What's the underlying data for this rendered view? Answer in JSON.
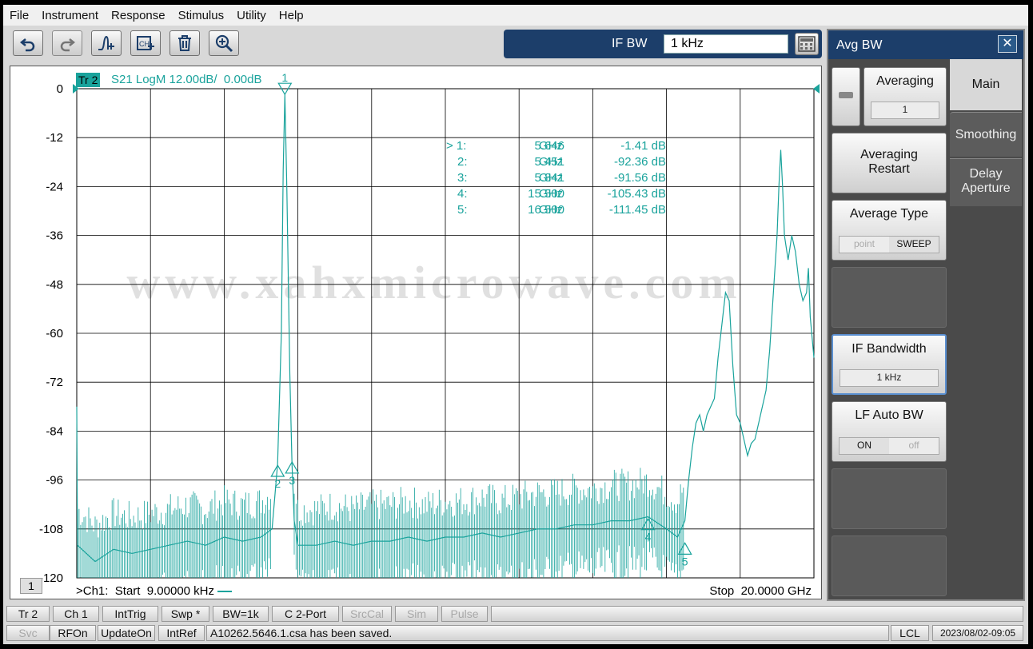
{
  "menu": [
    "File",
    "Instrument",
    "Response",
    "Stimulus",
    "Utility",
    "Help"
  ],
  "toolbar": {
    "icons": [
      "undo-icon",
      "redo-icon",
      "marker-add-icon",
      "channel-add-icon",
      "trash-icon",
      "zoom-in-icon"
    ]
  },
  "ifbw": {
    "label": "IF BW",
    "value": "1 kHz"
  },
  "trace": {
    "badge": "Tr 2",
    "label": "S21 LogM 12.00dB/  0.00dB",
    "channel_num": "1",
    "start_label": ">Ch1:  Start  9.00000 kHz",
    "stop_label": "Stop  20.0000 GHz"
  },
  "watermark": "www.xahxmicrowave.com",
  "markers": [
    {
      "id": "1",
      "prefix": "> 1:",
      "freq": "5.646",
      "unit": "GHz",
      "value": "-1.41 dB"
    },
    {
      "id": "2",
      "prefix": "2:",
      "freq": "5.451",
      "unit": "GHz",
      "value": "-92.36 dB"
    },
    {
      "id": "3",
      "prefix": "3:",
      "freq": "5.841",
      "unit": "GHz",
      "value": "-91.56 dB"
    },
    {
      "id": "4",
      "prefix": "4:",
      "freq": "15.500",
      "unit": "GHz",
      "value": "-105.43 dB"
    },
    {
      "id": "5",
      "prefix": "5:",
      "freq": "16.500",
      "unit": "GHz",
      "value": "-111.45 dB"
    }
  ],
  "chart_data": {
    "type": "line",
    "yticks": [
      "0",
      "-12",
      "-24",
      "-36",
      "-48",
      "-60",
      "-72",
      "-84",
      "-96",
      "-108",
      "-120"
    ],
    "ylim": [
      -120,
      0
    ],
    "xlim_ghz": [
      9e-06,
      20
    ],
    "grid": true,
    "series": [
      {
        "color": "#1aa39c",
        "points": [
          [
            0.0,
            -78
          ],
          [
            0.02,
            -112
          ],
          [
            0.5,
            -116
          ],
          [
            1.0,
            -113
          ],
          [
            1.5,
            -114
          ],
          [
            2.0,
            -113
          ],
          [
            2.5,
            -112
          ],
          [
            3.0,
            -111
          ],
          [
            3.5,
            -112
          ],
          [
            4.0,
            -110
          ],
          [
            4.5,
            -111
          ],
          [
            5.0,
            -110
          ],
          [
            5.3,
            -108
          ],
          [
            5.45,
            -92
          ],
          [
            5.55,
            -60
          ],
          [
            5.6,
            -20
          ],
          [
            5.646,
            -1.4
          ],
          [
            5.7,
            -25
          ],
          [
            5.78,
            -70
          ],
          [
            5.84,
            -92
          ],
          [
            5.9,
            -106
          ],
          [
            6.0,
            -112
          ],
          [
            6.5,
            -112
          ],
          [
            7.0,
            -111
          ],
          [
            7.5,
            -112
          ],
          [
            8.0,
            -111
          ],
          [
            8.5,
            -111
          ],
          [
            9.0,
            -110
          ],
          [
            9.5,
            -111
          ],
          [
            10.0,
            -110
          ],
          [
            10.5,
            -110
          ],
          [
            11.0,
            -109
          ],
          [
            11.5,
            -110
          ],
          [
            12.0,
            -109
          ],
          [
            12.5,
            -108
          ],
          [
            13.0,
            -108
          ],
          [
            13.5,
            -107
          ],
          [
            14.0,
            -107
          ],
          [
            14.5,
            -106
          ],
          [
            15.0,
            -106
          ],
          [
            15.5,
            -105
          ],
          [
            16.0,
            -108
          ],
          [
            16.3,
            -110
          ],
          [
            16.5,
            -106
          ],
          [
            16.6,
            -96
          ],
          [
            16.7,
            -88
          ],
          [
            16.8,
            -82
          ],
          [
            16.9,
            -80
          ],
          [
            17.0,
            -84
          ],
          [
            17.1,
            -80
          ],
          [
            17.2,
            -78
          ],
          [
            17.3,
            -76
          ],
          [
            17.4,
            -66
          ],
          [
            17.5,
            -58
          ],
          [
            17.6,
            -50
          ],
          [
            17.7,
            -52
          ],
          [
            17.8,
            -68
          ],
          [
            17.9,
            -80
          ],
          [
            18.0,
            -82
          ],
          [
            18.1,
            -86
          ],
          [
            18.2,
            -90
          ],
          [
            18.3,
            -87
          ],
          [
            18.4,
            -86
          ],
          [
            18.5,
            -82
          ],
          [
            18.6,
            -78
          ],
          [
            18.7,
            -74
          ],
          [
            18.8,
            -64
          ],
          [
            18.9,
            -50
          ],
          [
            19.0,
            -36
          ],
          [
            19.05,
            -24
          ],
          [
            19.1,
            -15
          ],
          [
            19.15,
            -24
          ],
          [
            19.2,
            -36
          ],
          [
            19.3,
            -42
          ],
          [
            19.4,
            -36
          ],
          [
            19.5,
            -40
          ],
          [
            19.6,
            -48
          ],
          [
            19.7,
            -52
          ],
          [
            19.8,
            -50
          ],
          [
            19.85,
            -44
          ],
          [
            19.9,
            -56
          ],
          [
            20.0,
            -66
          ]
        ]
      }
    ],
    "marker_points": [
      {
        "id": "1",
        "x": 5.646,
        "y": -1.41
      },
      {
        "id": "2",
        "x": 5.451,
        "y": -92.36
      },
      {
        "id": "3",
        "x": 5.841,
        "y": -91.56
      },
      {
        "id": "4",
        "x": 15.5,
        "y": -105.43
      },
      {
        "id": "5",
        "x": 16.5,
        "y": -111.45
      }
    ]
  },
  "panel": {
    "title": "Avg BW",
    "close": "✕",
    "buttons": {
      "averaging": {
        "title": "Averaging",
        "value": "1"
      },
      "restart": {
        "line1": "Averaging",
        "line2": "Restart"
      },
      "avg_type": {
        "title": "Average Type",
        "opt_off": "point",
        "opt_on": "SWEEP"
      },
      "if_bw": {
        "title": "IF Bandwidth",
        "value": "1 kHz"
      },
      "lf_auto": {
        "title": "LF Auto BW",
        "opt_on": "ON",
        "opt_off": "off"
      }
    },
    "tabs": {
      "main": "Main",
      "smoothing": "Smoothing",
      "delay1": "Delay",
      "delay2": "Aperture"
    }
  },
  "status_row1": [
    "Tr 2",
    "Ch 1",
    "IntTrig",
    "Swp *",
    "BW=1k",
    "C  2-Port",
    "SrcCal",
    "Sim",
    "Pulse"
  ],
  "status_row2": {
    "svc": "Svc",
    "rfon": "RFOn",
    "update": "UpdateOn",
    "intref": "IntRef",
    "message": "A10262.5646.1.csa has been saved.",
    "lcl": "LCL",
    "datetime": "2023/08/02-09:05"
  }
}
